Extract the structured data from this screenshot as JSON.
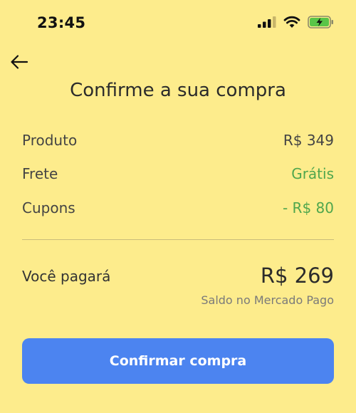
{
  "status_bar": {
    "time": "23:45",
    "icons": [
      "signal-icon",
      "wifi-icon",
      "battery-charging-icon"
    ]
  },
  "header": {
    "back_icon": "arrow-left-icon",
    "title": "Confirme a sua compra"
  },
  "summary": {
    "items": [
      {
        "label": "Produto",
        "value": "R$ 349"
      },
      {
        "label": "Frete",
        "value": "Grátis"
      },
      {
        "label": "Cupons",
        "value": "- R$ 80"
      }
    ]
  },
  "total": {
    "label": "Você pagará",
    "amount": "R$ 269",
    "payment_method": "Saldo no Mercado Pago"
  },
  "actions": {
    "confirm_label": "Confirmar compra"
  },
  "colors": {
    "background": "#FDEC8C",
    "accent_green": "#4FA64D",
    "button_blue": "#4C84F0",
    "battery_green": "#59C548"
  }
}
